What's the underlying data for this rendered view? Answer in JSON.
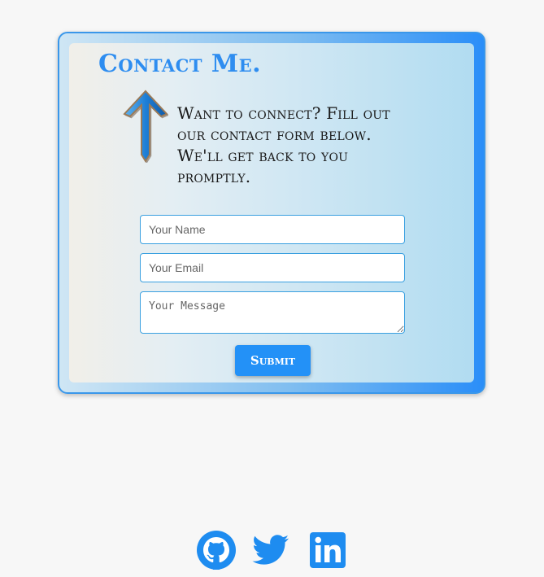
{
  "contact": {
    "title": "Contact Me.",
    "blurb": "Want to connect? Fill out our contact form below. We'll get back to you promptly.",
    "form": {
      "name_placeholder": "Your Name",
      "email_placeholder": "Your Email",
      "message_placeholder": "Your Message",
      "submit_label": "Submit"
    }
  },
  "icons": {
    "decoration": "up-arrow-icon",
    "social": [
      "github-icon",
      "twitter-icon",
      "linkedin-icon"
    ]
  },
  "colors": {
    "accent": "#2391f7",
    "page_background": "#f7f7f7"
  }
}
